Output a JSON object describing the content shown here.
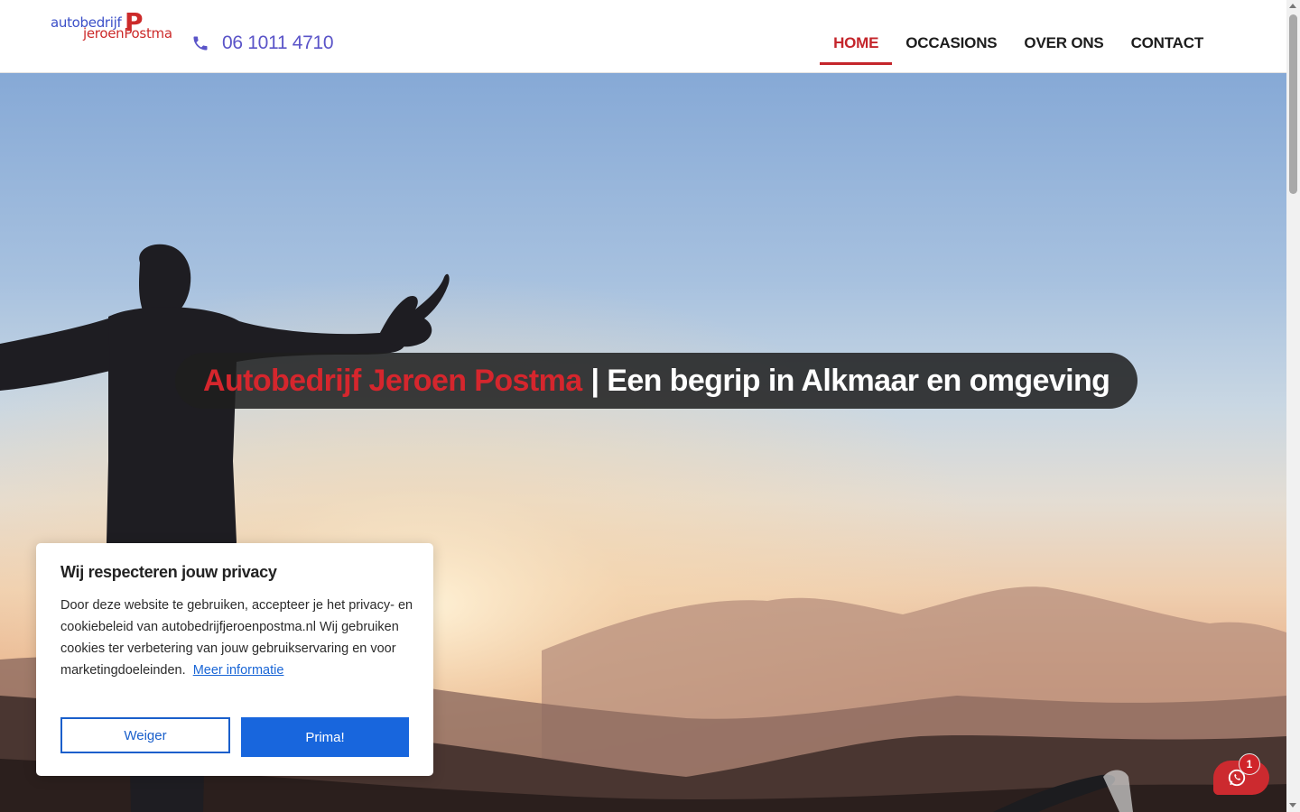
{
  "header": {
    "logo": {
      "line1": "autobedrijf",
      "line2": "jeroenPostma",
      "mark": "P"
    },
    "phone": {
      "icon": "phone-icon",
      "number": "06 1011 4710"
    },
    "nav": [
      {
        "label": "HOME",
        "active": true
      },
      {
        "label": "OCCASIONS",
        "active": false
      },
      {
        "label": "OVER ONS",
        "active": false
      },
      {
        "label": "CONTACT",
        "active": false
      }
    ]
  },
  "hero": {
    "title_brand": "Autobedrijf Jeroen Postma",
    "title_rest": "| Een begrip in Alkmaar en omgeving"
  },
  "cookie": {
    "title": "Wij respecteren jouw privacy",
    "text": "Door deze website te gebruiken, accepteer je het privacy- en cookiebeleid van autobedrijfjeroenpostma.nl Wij gebruiken cookies ter verbetering van jouw gebruikservaring en voor marketingdoeleinden.",
    "link": "Meer informatie",
    "decline": "Weiger",
    "accept": "Prima!"
  },
  "chat": {
    "icon": "whatsapp-icon",
    "badge": "1"
  },
  "colors": {
    "brand_red": "#c4252b",
    "phone_blue": "#5a54c8",
    "button_blue": "#1866dd"
  }
}
